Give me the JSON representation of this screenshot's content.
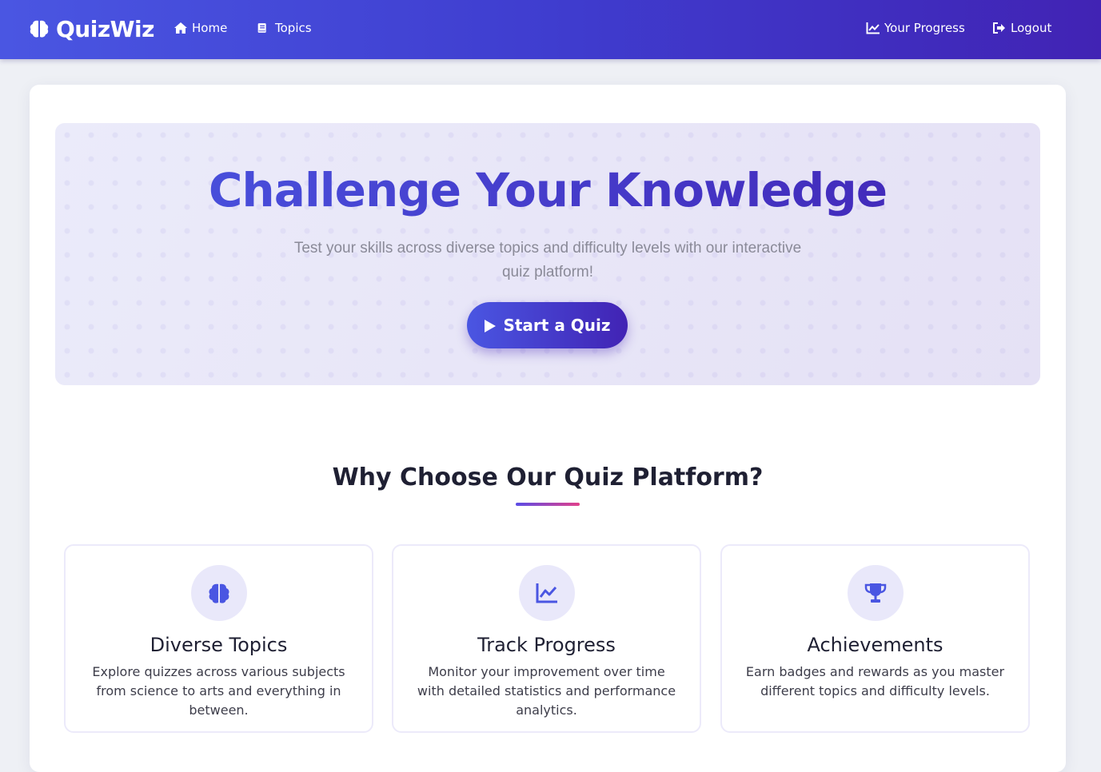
{
  "colors": {
    "brand_gradient_start": "#4a56e2",
    "brand_gradient_end": "#4123b4",
    "underline_start": "#5b4ce6",
    "underline_end": "#e2408a",
    "icon_color": "#4a56e2"
  },
  "nav": {
    "brand": "QuizWiz",
    "brand_icon": "brain-icon",
    "links": [
      {
        "label": "Home",
        "icon": "home-icon"
      },
      {
        "label": "Topics",
        "icon": "book-icon"
      },
      {
        "label": "Your Progress",
        "icon": "chart-line-icon"
      },
      {
        "label": "Logout",
        "icon": "logout-icon"
      }
    ]
  },
  "hero": {
    "title": "Challenge Your Knowledge",
    "subtitle": "Test your skills across diverse topics and difficulty levels with our interactive quiz platform!",
    "button_label": "Start a Quiz",
    "button_icon": "play-icon"
  },
  "features_section": {
    "title": "Why Choose Our Quiz Platform?",
    "items": [
      {
        "icon": "brain-icon",
        "title": "Diverse Topics",
        "description": "Explore quizzes across various subjects from science to arts and everything in between."
      },
      {
        "icon": "chart-line-icon",
        "title": "Track Progress",
        "description": "Monitor your improvement over time with detailed statistics and performance analytics."
      },
      {
        "icon": "trophy-icon",
        "title": "Achievements",
        "description": "Earn badges and rewards as you master different topics and difficulty levels."
      }
    ]
  }
}
